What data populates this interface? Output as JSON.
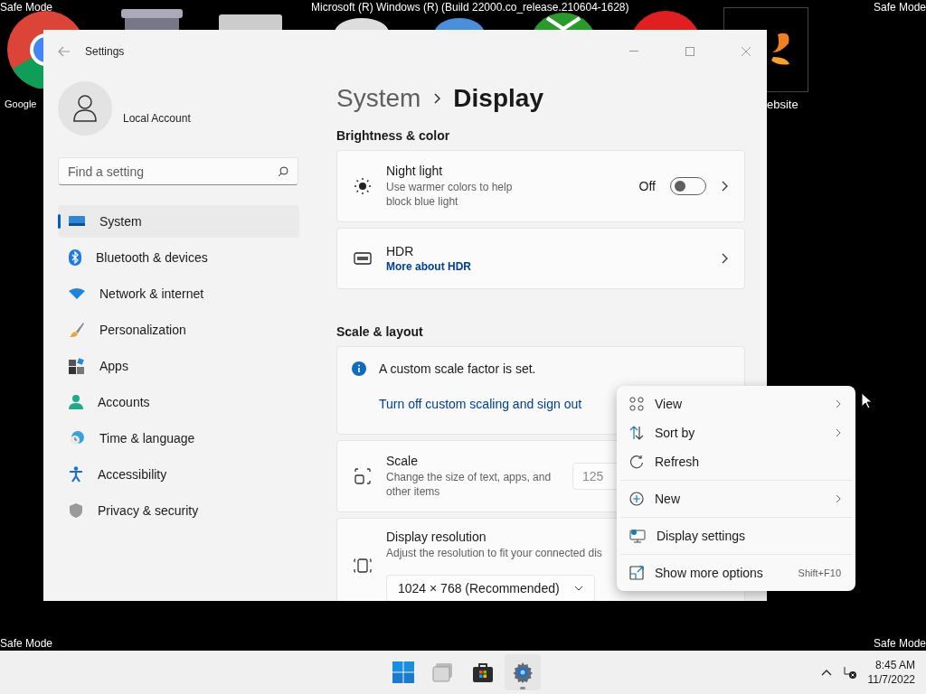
{
  "desktop": {
    "banner": "Microsoft (R) Windows (R) (Build 22000.co_release.210604-1628)",
    "corner_labels": [
      "Safe Mode",
      "Safe Mode",
      "Safe Mode",
      "Safe Mode"
    ],
    "icons": [
      {
        "label": "Google"
      },
      {
        "label": "ebsite"
      }
    ]
  },
  "window": {
    "title": "Settings",
    "account": "Local Account",
    "search": {
      "placeholder": "Find a setting"
    },
    "nav": [
      {
        "label": "System",
        "selected": true
      },
      {
        "label": "Bluetooth & devices",
        "selected": false
      },
      {
        "label": "Network & internet",
        "selected": false
      },
      {
        "label": "Personalization",
        "selected": false
      },
      {
        "label": "Apps",
        "selected": false
      },
      {
        "label": "Accounts",
        "selected": false
      },
      {
        "label": "Time & language",
        "selected": false
      },
      {
        "label": "Accessibility",
        "selected": false
      },
      {
        "label": "Privacy & security",
        "selected": false
      }
    ],
    "breadcrumb": [
      "System",
      "Display"
    ],
    "sections": [
      {
        "heading": "Brightness & color",
        "cards": [
          {
            "kind": "toggle",
            "title": "Night light",
            "description": "Use warmer colors to help block blue light",
            "state": "Off",
            "on": false
          },
          {
            "kind": "link",
            "title": "HDR",
            "link": "More about HDR"
          }
        ]
      },
      {
        "heading": "Scale & layout",
        "cards": [
          {
            "kind": "info",
            "message": "A custom scale factor is set.",
            "link": "Turn off custom scaling and sign out"
          },
          {
            "kind": "dropdown",
            "title": "Scale",
            "description": "Change the size of text, apps, and other items",
            "value": "125"
          },
          {
            "kind": "select",
            "title": "Display resolution",
            "description": "Adjust the resolution to fit your connected dis",
            "value": "1024 × 768 (Recommended)"
          }
        ]
      }
    ]
  },
  "context_menu": {
    "groups": [
      [
        {
          "label": "View",
          "submenu": true
        },
        {
          "label": "Sort by",
          "submenu": true
        },
        {
          "label": "Refresh",
          "submenu": false
        }
      ],
      [
        {
          "label": "New",
          "submenu": true
        }
      ],
      [
        {
          "label": "Display settings",
          "submenu": false
        }
      ],
      [
        {
          "label": "Show more options",
          "submenu": false,
          "shortcut": "Shift+F10"
        }
      ]
    ]
  },
  "taskbar": {
    "apps": [
      {
        "selected": false
      },
      {
        "selected": false
      },
      {
        "selected": false
      },
      {
        "selected": true
      }
    ],
    "time": "8:45 AM",
    "date": "11/7/2022"
  }
}
